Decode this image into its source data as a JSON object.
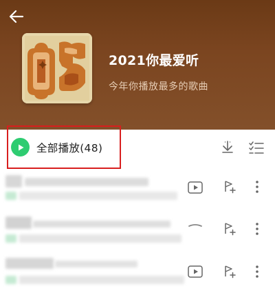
{
  "header": {
    "back_icon": "back-arrow-icon",
    "title": "2021你最爱听",
    "subtitle": "今年你播放最多的歌曲",
    "background_color": "#7b4520"
  },
  "play_all": {
    "label": "全部播放(48)",
    "icon": "play-circle-icon",
    "icon_color": "#2ecc71",
    "highlight_color": "#d81e1e"
  },
  "toolbar": {
    "download_icon": "download-icon",
    "multiselect_icon": "multi-select-icon"
  },
  "songs": [
    {
      "title": "",
      "artist": "",
      "actions": [
        "mv-icon",
        "add-to-playlist-icon",
        "more-icon"
      ]
    },
    {
      "title": "",
      "artist": "",
      "actions": [
        "playing-indicator-icon",
        "add-to-playlist-icon",
        "more-icon"
      ]
    },
    {
      "title": "",
      "artist": "",
      "actions": [
        "mv-icon",
        "add-to-playlist-icon",
        "more-icon"
      ]
    }
  ]
}
